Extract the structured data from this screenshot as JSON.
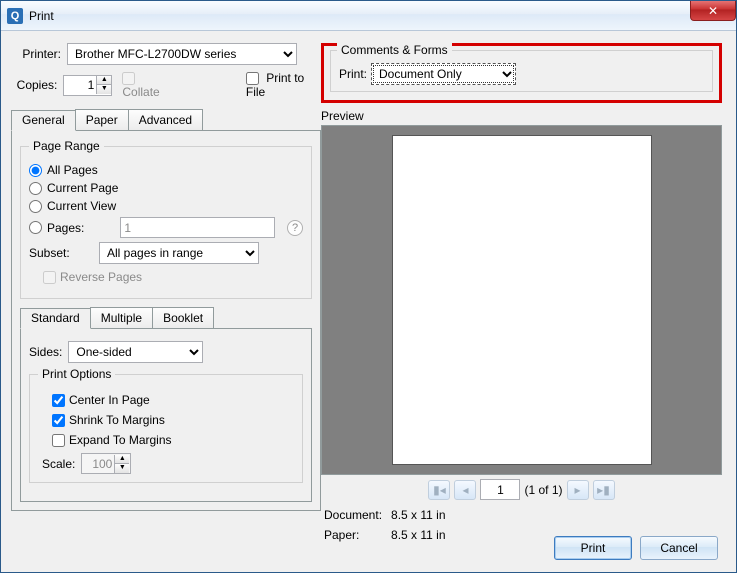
{
  "window": {
    "title": "Print"
  },
  "printer": {
    "label": "Printer:",
    "selected": "Brother MFC-L2700DW series",
    "copies_label": "Copies:",
    "copies": "1",
    "collate": "Collate",
    "print_to_file": "Print to File"
  },
  "tabs": {
    "general": "General",
    "paper": "Paper",
    "advanced": "Advanced"
  },
  "page_range": {
    "legend": "Page Range",
    "all": "All Pages",
    "current_page": "Current Page",
    "current_view": "Current View",
    "pages": "Pages:",
    "pages_value": "1",
    "subset_label": "Subset:",
    "subset_value": "All pages in range",
    "reverse": "Reverse Pages"
  },
  "tabs2": {
    "standard": "Standard",
    "multiple": "Multiple",
    "booklet": "Booklet"
  },
  "sides": {
    "label": "Sides:",
    "value": "One-sided"
  },
  "print_options": {
    "legend": "Print Options",
    "center": "Center In Page",
    "shrink": "Shrink To Margins",
    "expand": "Expand To Margins",
    "scale_label": "Scale:",
    "scale_value": "100"
  },
  "comments_forms": {
    "legend": "Comments & Forms",
    "label": "Print:",
    "value": "Document Only"
  },
  "preview": {
    "legend": "Preview",
    "page_num": "1",
    "page_of": "(1 of 1)",
    "document_label": "Document:",
    "document_size": "8.5 x 11 in",
    "paper_label": "Paper:",
    "paper_size": "8.5 x 11 in"
  },
  "buttons": {
    "print": "Print",
    "cancel": "Cancel"
  }
}
